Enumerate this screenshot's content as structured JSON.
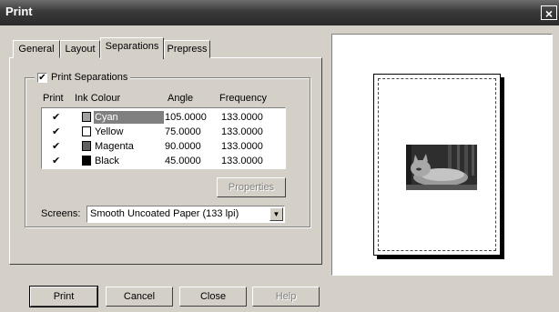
{
  "window": {
    "title": "Print",
    "close_glyph": "×"
  },
  "tabs": [
    {
      "label": "General",
      "active": false
    },
    {
      "label": "Layout",
      "active": false
    },
    {
      "label": "Separations",
      "active": true
    },
    {
      "label": "Prepress",
      "active": false
    }
  ],
  "separations": {
    "checkbox_label": "Print Separations",
    "checked": true,
    "columns": {
      "print": "Print",
      "ink": "Ink Colour",
      "angle": "Angle",
      "frequency": "Frequency"
    },
    "inks": [
      {
        "check": "✔",
        "name": "Cyan",
        "swatch": "#a0a0a0",
        "angle": "105.0000",
        "frequency": "133.0000",
        "selected": true
      },
      {
        "check": "✔",
        "name": "Yellow",
        "swatch": "#ffffff",
        "angle": "75.0000",
        "frequency": "133.0000",
        "selected": false
      },
      {
        "check": "✔",
        "name": "Magenta",
        "swatch": "#606060",
        "angle": "90.0000",
        "frequency": "133.0000",
        "selected": false
      },
      {
        "check": "✔",
        "name": "Black",
        "swatch": "#000000",
        "angle": "45.0000",
        "frequency": "133.0000",
        "selected": false
      }
    ],
    "properties_label": "Properties",
    "screens_label": "Screens:",
    "screens_value": "Smooth Uncoated Paper (133 lpi)"
  },
  "footer": {
    "print": "Print",
    "cancel": "Cancel",
    "close": "Close",
    "help": "Help"
  },
  "colors": {
    "selection": "#808080",
    "titlebar": "#3a3a3a",
    "face": "#d4d0c8"
  }
}
